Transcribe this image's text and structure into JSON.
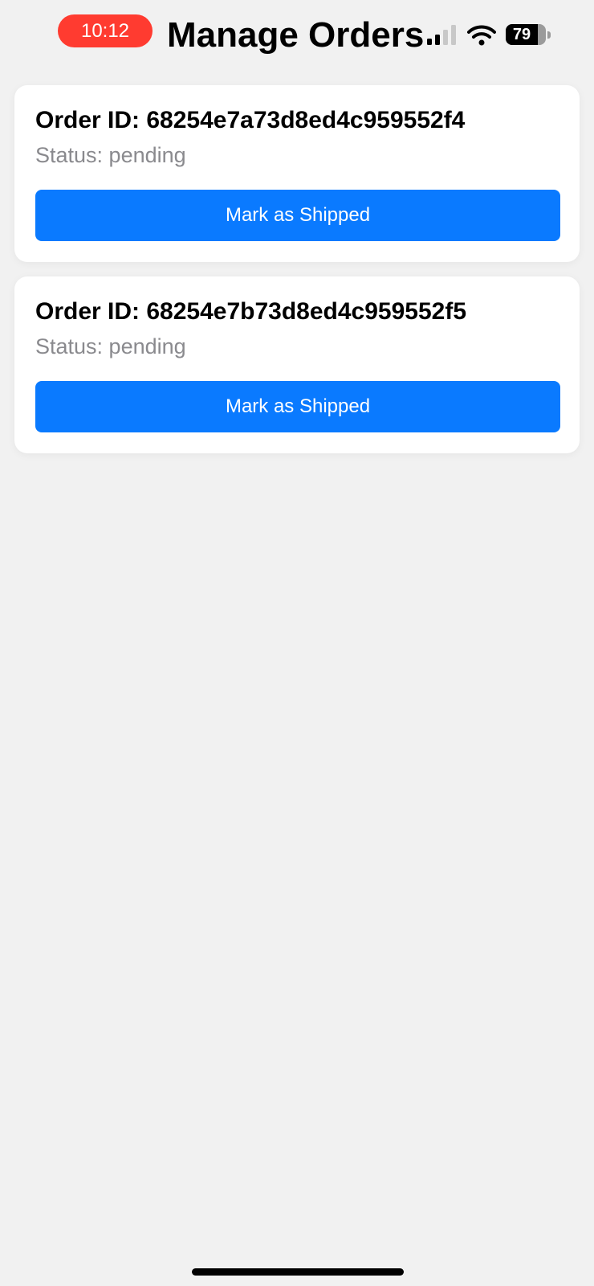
{
  "status_bar": {
    "time": "10:12",
    "battery_level": "79",
    "signal_icon": "cellular-signal-icon",
    "wifi_icon": "wifi-icon",
    "battery_icon": "battery-icon"
  },
  "header": {
    "title": "Manage Orders"
  },
  "orders": [
    {
      "id_label": "Order ID: 68254e7a73d8ed4c959552f4",
      "status_label": "Status: pending",
      "button_label": "Mark as Shipped"
    },
    {
      "id_label": "Order ID: 68254e7b73d8ed4c959552f5",
      "status_label": "Status: pending",
      "button_label": "Mark as Shipped"
    }
  ],
  "colors": {
    "accent": "#0a7aff",
    "time_pill": "#ff3b30",
    "background": "#f1f1f1",
    "status_text": "#8a8a8e"
  }
}
